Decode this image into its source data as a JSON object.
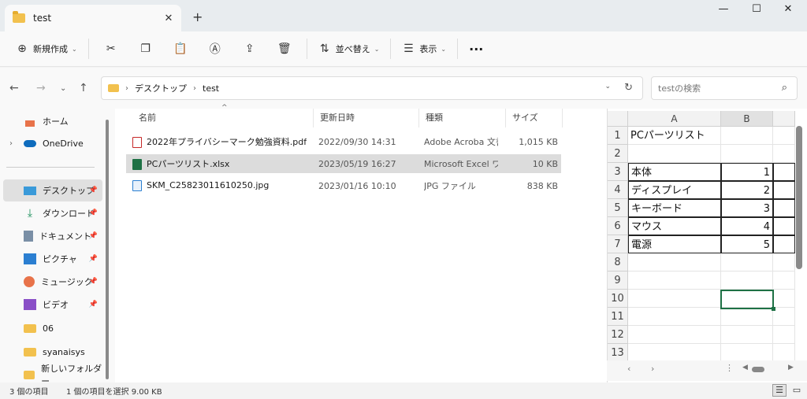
{
  "window": {
    "tab_title": "test",
    "new_tab": "+",
    "minimize": "—",
    "maximize": "☐",
    "close": "✕"
  },
  "toolbar": {
    "new_label": "新規作成",
    "sort_label": "並べ替え",
    "view_label": "表示",
    "more": "···"
  },
  "address": {
    "crumbs": [
      "デスクトップ",
      "test"
    ]
  },
  "search": {
    "placeholder": "testの検索"
  },
  "sidebar": {
    "items": [
      {
        "label": "ホーム"
      },
      {
        "label": "OneDrive"
      },
      {
        "label": "デスクトップ"
      },
      {
        "label": "ダウンロード"
      },
      {
        "label": "ドキュメント"
      },
      {
        "label": "ピクチャ"
      },
      {
        "label": "ミュージック"
      },
      {
        "label": "ビデオ"
      },
      {
        "label": "06"
      },
      {
        "label": "syanaisys"
      },
      {
        "label": "新しいフォルダー"
      }
    ]
  },
  "columns": {
    "name": "名前",
    "date": "更新日時",
    "type": "種類",
    "size": "サイズ"
  },
  "files": [
    {
      "name": "2022年プライバシーマーク勉強資料.pdf",
      "date": "2022/09/30 14:31",
      "type": "Adobe Acroba 文書",
      "size": "1,015 KB",
      "kind": "pdf"
    },
    {
      "name": "PCパーツリスト.xlsx",
      "date": "2023/05/19 16:27",
      "type": "Microsoft Excel ワ...",
      "size": "10 KB",
      "kind": "xlsx",
      "selected": true
    },
    {
      "name": "SKM_C25823011610250.jpg",
      "date": "2023/01/16 10:10",
      "type": "JPG ファイル",
      "size": "838 KB",
      "kind": "jpg"
    }
  ],
  "preview": {
    "col_headers": [
      "A",
      "B"
    ],
    "row_numbers": [
      "1",
      "2",
      "3",
      "4",
      "5",
      "6",
      "7",
      "8",
      "9",
      "10",
      "11",
      "12",
      "13"
    ],
    "cells": {
      "a1": "PCパーツリスト",
      "a3": "本体",
      "b3": "1",
      "a4": "ディスプレイ",
      "b4": "2",
      "a5": "キーボード",
      "b5": "3",
      "a6": "マウス",
      "b6": "4",
      "a7": "電源",
      "b7": "5"
    }
  },
  "status": {
    "count": "3 個の項目",
    "selection": "1 個の項目を選択  9.00 KB"
  },
  "colors": {
    "excel_green": "#1e7145",
    "folder": "#f2c14e",
    "accent": "#0067c0"
  }
}
